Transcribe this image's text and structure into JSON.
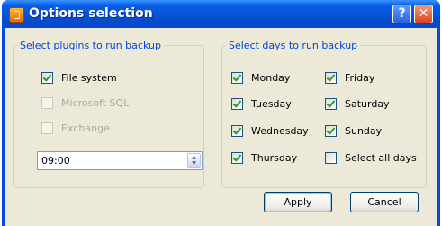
{
  "window": {
    "title": "Options selection",
    "help_label": "?",
    "close_label": "✕"
  },
  "plugins": {
    "legend": "Select plugins to run backup",
    "items": [
      {
        "label": "File system",
        "checked": true,
        "enabled": true
      },
      {
        "label": "Microsoft SQL",
        "checked": false,
        "enabled": false
      },
      {
        "label": "Exchange",
        "checked": false,
        "enabled": false
      }
    ],
    "time_value": "09:00"
  },
  "days": {
    "legend": "Select days to run backup",
    "items": [
      {
        "label": "Monday",
        "checked": true
      },
      {
        "label": "Tuesday",
        "checked": true
      },
      {
        "label": "Wednesday",
        "checked": true
      },
      {
        "label": "Thursday",
        "checked": true
      },
      {
        "label": "Friday",
        "checked": true
      },
      {
        "label": "Saturday",
        "checked": true
      },
      {
        "label": "Sunday",
        "checked": true
      },
      {
        "label": "Select all days",
        "checked": false
      }
    ]
  },
  "buttons": {
    "apply": "Apply",
    "cancel": "Cancel"
  }
}
